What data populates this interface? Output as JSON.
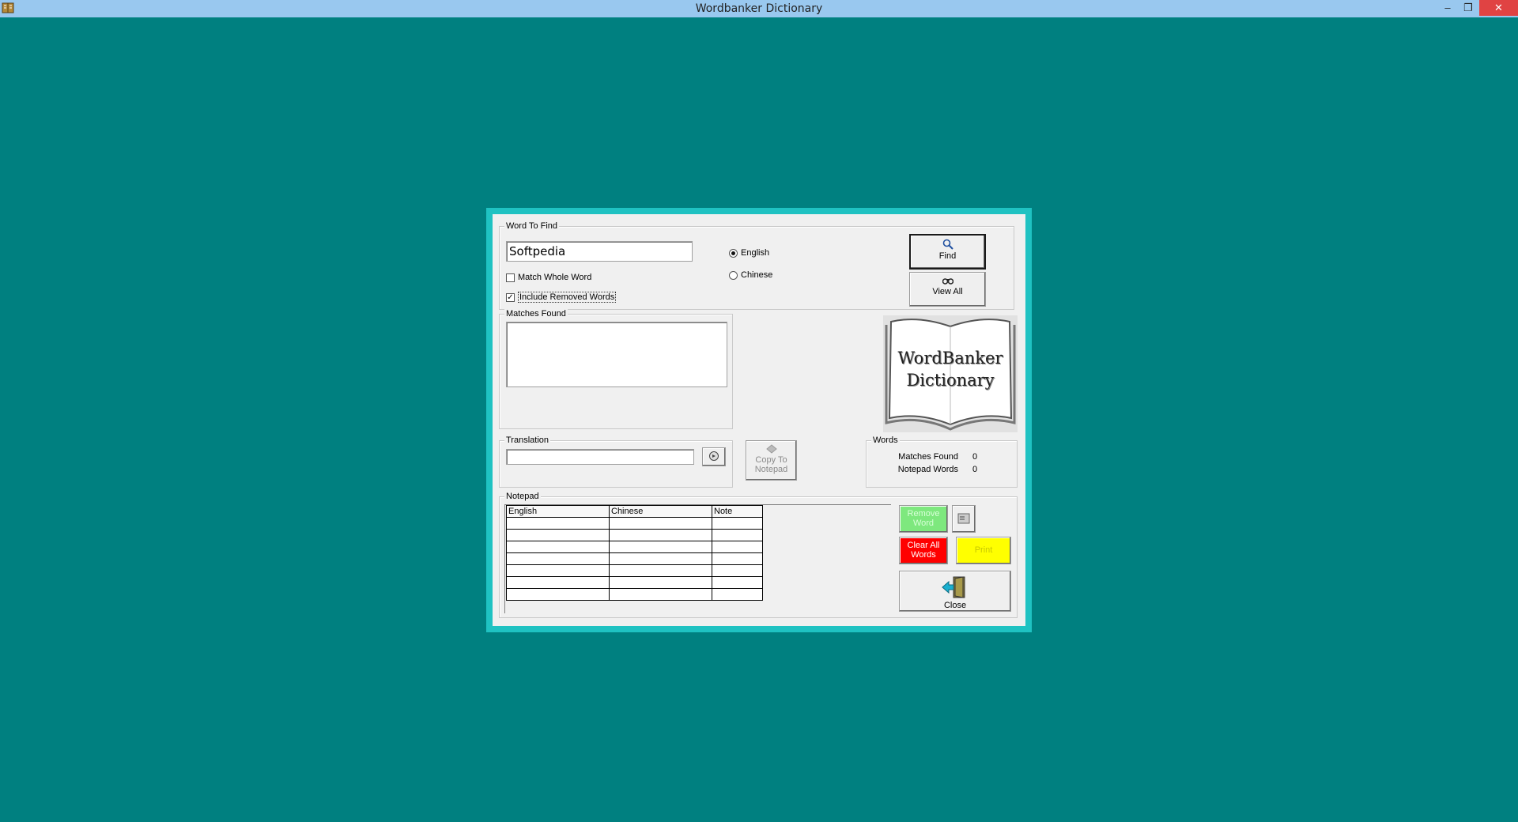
{
  "window": {
    "title": "Wordbanker Dictionary",
    "minimize_glyph": "–",
    "restore_glyph": "❐",
    "close_glyph": "✕"
  },
  "search": {
    "group_label": "Word To Find",
    "word_value": "Softpedia",
    "match_whole_word_label": "Match Whole Word",
    "match_whole_word_checked": false,
    "include_removed_label": "Include Removed Words",
    "include_removed_checked": true,
    "languages": [
      {
        "label": "English",
        "selected": true
      },
      {
        "label": "Chinese",
        "selected": false
      }
    ],
    "find_label": "Find",
    "view_all_label": "View All"
  },
  "matches": {
    "group_label": "Matches Found"
  },
  "translation": {
    "group_label": "Translation",
    "value": ""
  },
  "copy_to_notepad_label": "Copy To Notepad",
  "logo": {
    "line1": "WordBanker",
    "line2": "Dictionary"
  },
  "words": {
    "group_label": "Words",
    "matches_found_label": "Matches Found",
    "matches_found_value": "0",
    "notepad_words_label": "Notepad Words",
    "notepad_words_value": "0"
  },
  "notepad": {
    "group_label": "Notepad",
    "columns": [
      "English",
      "Chinese",
      "Note"
    ],
    "rows": [
      [
        "",
        "",
        ""
      ],
      [
        "",
        "",
        ""
      ],
      [
        "",
        "",
        ""
      ],
      [
        "",
        "",
        ""
      ],
      [
        "",
        "",
        ""
      ],
      [
        "",
        "",
        ""
      ],
      [
        "",
        "",
        ""
      ]
    ]
  },
  "actions": {
    "remove_word_label": "Remove Word",
    "clear_all_label": "Clear All Words",
    "print_label": "Print",
    "close_label": "Close"
  },
  "colors": {
    "desktop": "#008080",
    "frame": "#1fc2c2",
    "remove_word_bg": "#7ee87e",
    "clear_all_bg": "#ff0000",
    "print_bg": "#ffff00"
  }
}
